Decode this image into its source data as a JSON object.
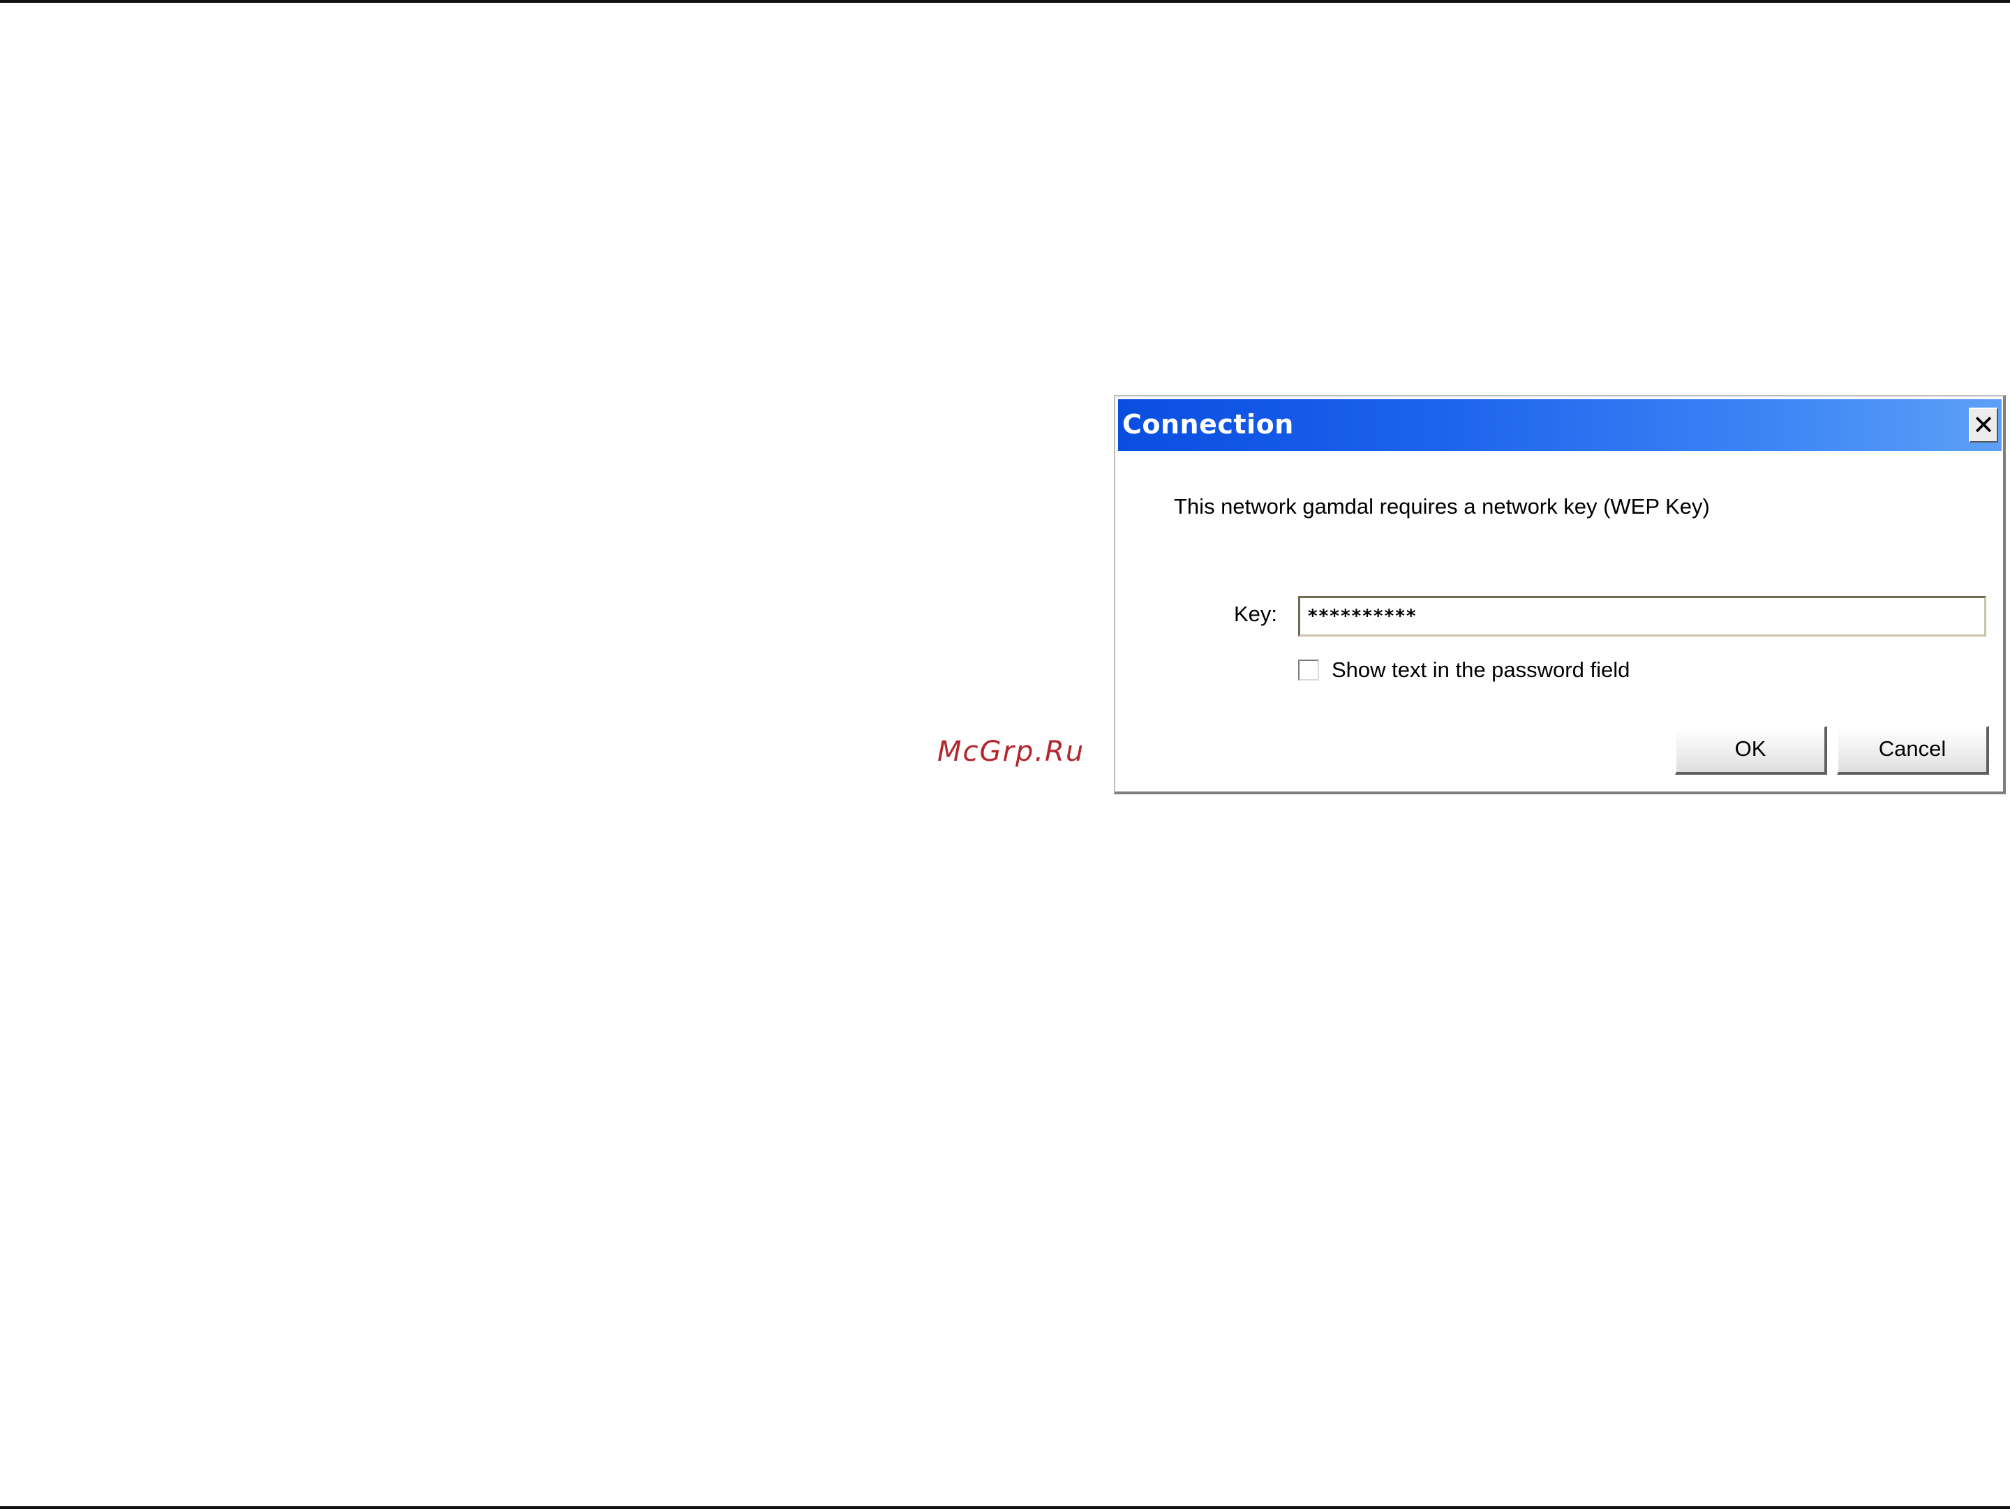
{
  "watermark": "McGrp.Ru",
  "dialog": {
    "title": "Connection",
    "close_icon": "close-icon",
    "message": "This network gamdal requires a network key (WEP Key)",
    "key_label": "Key:",
    "key_value": "**********",
    "show_text_label": "Show text in the password field",
    "show_text_checked": false,
    "ok_label": "OK",
    "cancel_label": "Cancel"
  },
  "colors": {
    "titlebar_start": "#0a4ee0",
    "titlebar_end": "#5ea0f7",
    "watermark": "#b3262d"
  }
}
